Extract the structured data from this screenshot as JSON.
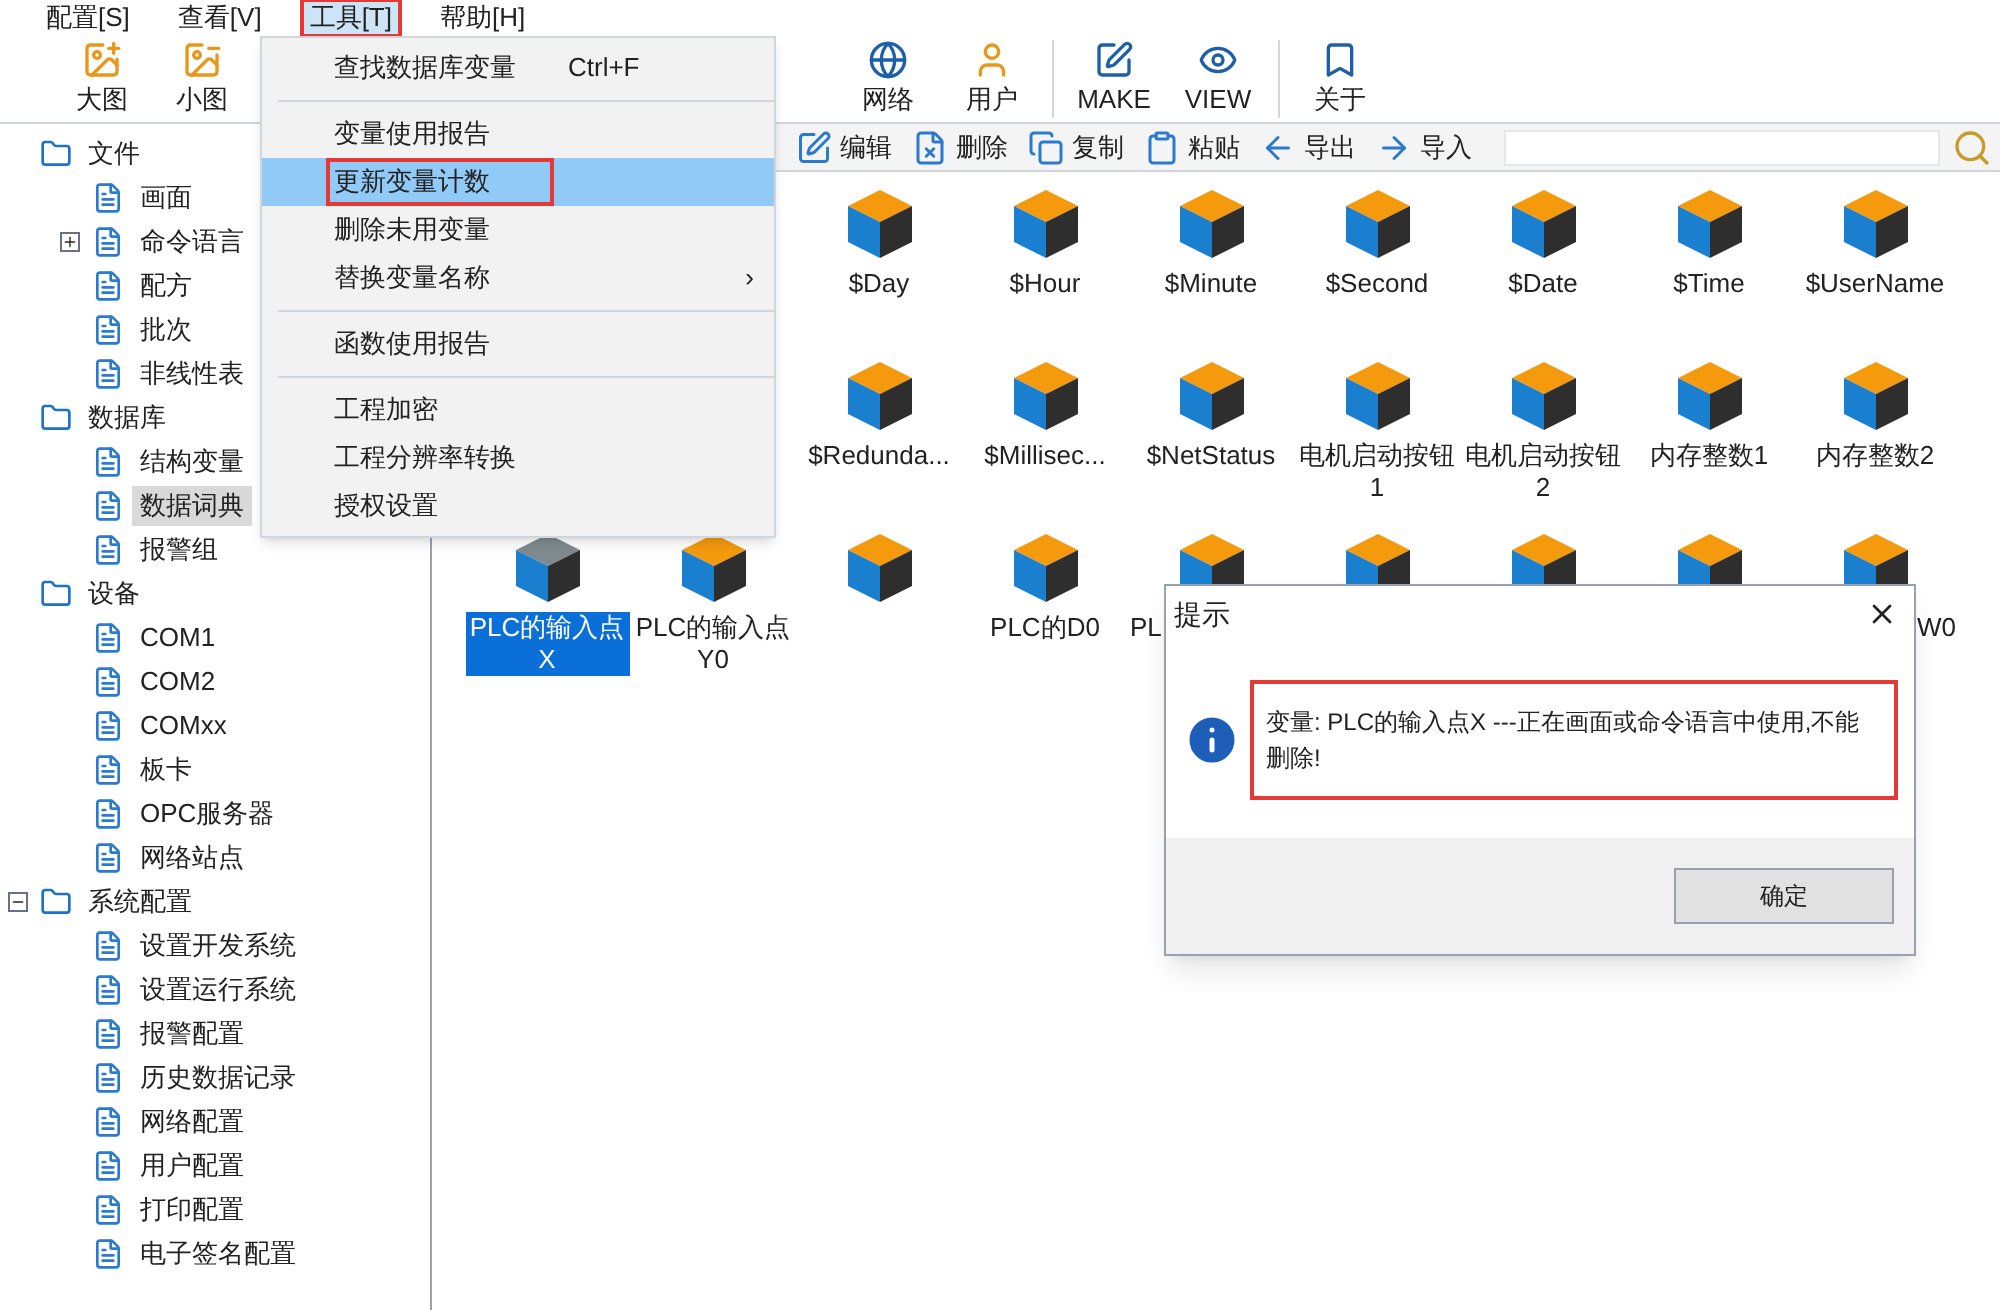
{
  "menu_bar": [
    {
      "label": "配置[S]",
      "selected": false,
      "marked": false
    },
    {
      "label": "查看[V]",
      "selected": false,
      "marked": false
    },
    {
      "label": "工具[T]",
      "selected": true,
      "marked": true
    },
    {
      "label": "帮助[H]",
      "selected": false,
      "marked": false
    }
  ],
  "toolbar": {
    "left": [
      "大图",
      "小图"
    ],
    "right": [
      [
        "网络",
        "用户"
      ],
      [
        "MAKE",
        "VIEW"
      ],
      [
        "关于"
      ]
    ]
  },
  "edit_toolbar": {
    "buttons": [
      "编辑",
      "删除",
      "复制",
      "粘贴",
      "导出",
      "导入"
    ]
  },
  "tree": [
    {
      "label": "文件",
      "selected": false,
      "children": [
        {
          "label": "画面",
          "selected": false
        },
        {
          "label": "命令语言",
          "selected": false,
          "expanded": false
        },
        {
          "label": "配方",
          "selected": false
        },
        {
          "label": "批次",
          "selected": false
        },
        {
          "label": "非线性表",
          "selected": false
        }
      ]
    },
    {
      "label": "数据库",
      "selected": false,
      "children": [
        {
          "label": "结构变量",
          "selected": false
        },
        {
          "label": "数据词典",
          "selected": true
        },
        {
          "label": "报警组",
          "selected": false
        }
      ]
    },
    {
      "label": "设备",
      "selected": false,
      "children": [
        {
          "label": "COM1",
          "selected": false
        },
        {
          "label": "COM2",
          "selected": false
        },
        {
          "label": "COMxx",
          "selected": false
        },
        {
          "label": "板卡",
          "selected": false
        },
        {
          "label": "OPC服务器",
          "selected": false
        },
        {
          "label": "网络站点",
          "selected": false
        }
      ]
    },
    {
      "label": "系统配置",
      "selected": false,
      "expanded": true,
      "children": [
        {
          "label": "设置开发系统",
          "selected": false
        },
        {
          "label": "设置运行系统",
          "selected": false
        },
        {
          "label": "报警配置",
          "selected": false
        },
        {
          "label": "历史数据记录",
          "selected": false
        },
        {
          "label": "网络配置",
          "selected": false
        },
        {
          "label": "用户配置",
          "selected": false
        },
        {
          "label": "打印配置",
          "selected": false
        },
        {
          "label": "电子签名配置",
          "selected": false
        }
      ]
    }
  ],
  "variables": [
    [
      {
        "kind": "full",
        "label": "$Day",
        "selected": false
      },
      {
        "kind": "full",
        "label": "$Hour",
        "selected": false
      },
      {
        "kind": "full",
        "label": "$Minute",
        "selected": false
      },
      {
        "kind": "full",
        "label": "$Second",
        "selected": false
      },
      {
        "kind": "full",
        "label": "$Date",
        "selected": false
      },
      {
        "kind": "full",
        "label": "$Time",
        "selected": false
      },
      {
        "kind": "full",
        "label": "$UserName",
        "selected": false
      }
    ],
    [
      {
        "kind": "full",
        "label": "$Redunda...",
        "selected": false
      },
      {
        "kind": "full",
        "label": "$Millisec...",
        "selected": false
      },
      {
        "kind": "full",
        "label": "$NetStatus",
        "selected": false
      },
      {
        "kind": "full",
        "label": "电机启动按钮1",
        "selected": false
      },
      {
        "kind": "full",
        "label": "电机启动按钮2",
        "selected": false
      },
      {
        "kind": "full",
        "label": "内存整数1",
        "selected": false
      },
      {
        "kind": "full",
        "label": "内存整数2",
        "selected": false
      }
    ],
    [
      {
        "kind": "full",
        "label": "PLC的输入点X",
        "selected": true
      },
      {
        "kind": "full",
        "label": "PLC的输入点Y0",
        "selected": false
      },
      {
        "kind": "icon",
        "selected": false
      },
      {
        "kind": "full",
        "label": "PLC的D0",
        "selected": false
      },
      {
        "kind": "start",
        "label": "PL",
        "selected": false
      },
      {
        "kind": "icon",
        "selected": false
      },
      {
        "kind": "icon",
        "selected": false
      },
      {
        "kind": "icon",
        "selected": false
      },
      {
        "kind": "end",
        "label": "W0",
        "selected": false
      }
    ]
  ],
  "tools_menu": [
    {
      "kind": "item",
      "label": "查找数据库变量",
      "shortcut": "Ctrl+F",
      "selected": false,
      "marked": false
    },
    {
      "kind": "separator"
    },
    {
      "kind": "item",
      "label": "变量使用报告",
      "selected": false,
      "marked": false
    },
    {
      "kind": "item",
      "label": "更新变量计数",
      "selected": true,
      "marked": true
    },
    {
      "kind": "item",
      "label": "删除未用变量",
      "selected": false,
      "marked": false
    },
    {
      "kind": "item",
      "label": "替换变量名称",
      "submenu": "›",
      "selected": false,
      "marked": false
    },
    {
      "kind": "separator"
    },
    {
      "kind": "item",
      "label": "函数使用报告",
      "selected": false,
      "marked": false
    },
    {
      "kind": "separator"
    },
    {
      "kind": "item",
      "label": "工程加密",
      "selected": false,
      "marked": false
    },
    {
      "kind": "item",
      "label": "工程分辨率转换",
      "selected": false,
      "marked": false
    },
    {
      "kind": "item",
      "label": "授权设置",
      "selected": false,
      "marked": false
    }
  ],
  "dialog": {
    "title": "提示",
    "message": "变量: PLC的输入点X ---正在画面或命令语言中使用,不能删除!",
    "marked": true,
    "button": "确定"
  }
}
